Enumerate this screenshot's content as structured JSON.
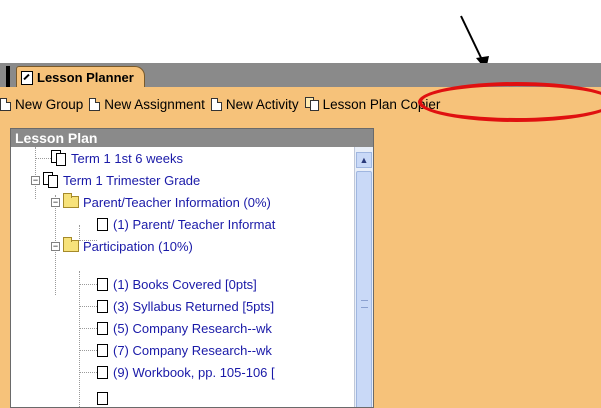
{
  "tab": {
    "label": "Lesson Planner"
  },
  "toolbar": {
    "items": [
      {
        "label": "New Group",
        "icon": "document-icon"
      },
      {
        "label": "New Assignment",
        "icon": "document-icon"
      },
      {
        "label": "New Activity",
        "icon": "document-icon"
      },
      {
        "label": "Lesson Plan Copier",
        "icon": "copy-icon"
      }
    ]
  },
  "panel": {
    "title": "Lesson Plan",
    "tree": [
      {
        "label": "Term 1 1st 6 weeks",
        "type": "term",
        "expander": ""
      },
      {
        "label": "Term 1 Trimester Grade",
        "type": "term",
        "expander": "−"
      },
      {
        "label": "Parent/Teacher Information (0%)",
        "type": "folder",
        "expander": "−"
      },
      {
        "label": "(1) Parent/ Teacher Informat",
        "type": "doc",
        "expander": ""
      },
      {
        "label": "Participation (10%)",
        "type": "folder",
        "expander": "−"
      },
      {
        "label": "(1) Books Covered [0pts]",
        "type": "doc",
        "expander": ""
      },
      {
        "label": "(3) Syllabus Returned [5pts]",
        "type": "doc",
        "expander": ""
      },
      {
        "label": "(5) Company Research--wk",
        "type": "doc",
        "expander": ""
      },
      {
        "label": "(7) Company Research--wk",
        "type": "doc",
        "expander": ""
      },
      {
        "label": "(9) Workbook, pp. 105-106 [",
        "type": "doc",
        "expander": ""
      }
    ]
  },
  "colors": {
    "accent": "#f6c27a",
    "highlight": "#e01010",
    "link": "#1a1aa8"
  }
}
